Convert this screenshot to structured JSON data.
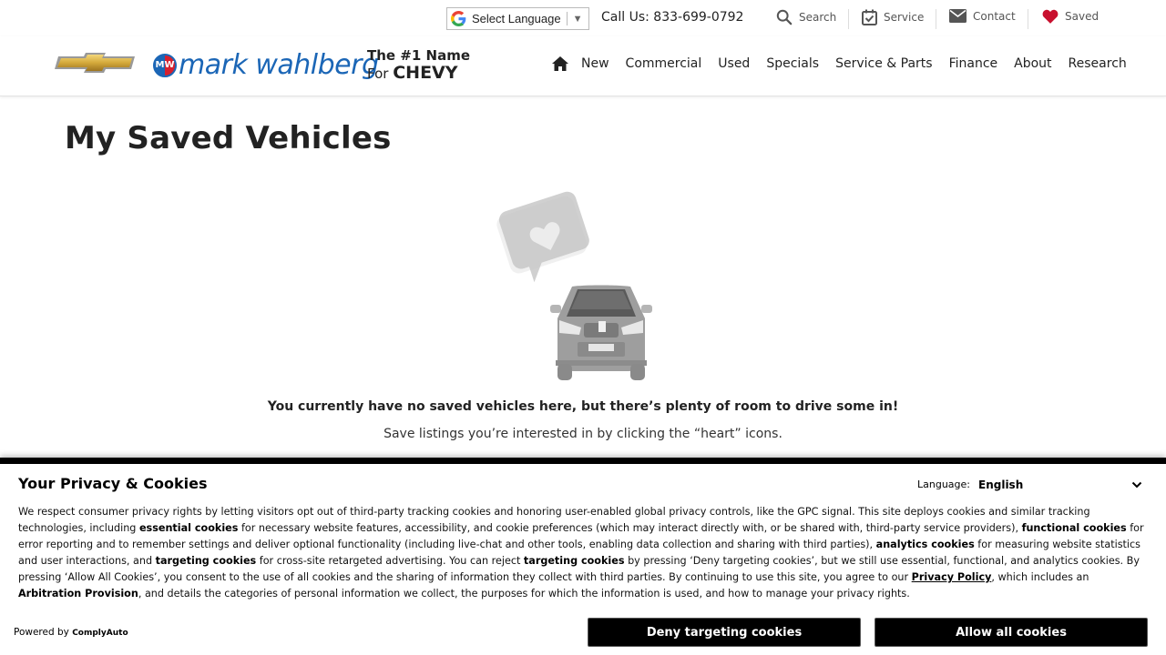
{
  "topbar": {
    "language_label": "Select Language",
    "call_label": "Call Us: 833-699-0792",
    "utility": [
      {
        "label": "Search",
        "icon": "search-icon"
      },
      {
        "label": "Service",
        "icon": "calendar-check-icon"
      },
      {
        "label": "Contact",
        "icon": "envelope-icon"
      },
      {
        "label": "Saved",
        "icon": "heart-icon"
      }
    ]
  },
  "header": {
    "brand_text": "mark wahlberg",
    "brand_badge": "MW",
    "tagline_line1": "The #1 Name",
    "tagline_for": "For",
    "tagline_chevy": "CHEVY",
    "nav": [
      "New",
      "Commercial",
      "Used",
      "Specials",
      "Service & Parts",
      "Finance",
      "About",
      "Research"
    ]
  },
  "main": {
    "title": "My Saved Vehicles",
    "empty_message": "You currently have no saved vehicles here, but there’s plenty of room to drive some in!",
    "empty_sub": "Save listings you’re interested in by clicking the “heart” icons."
  },
  "cookie": {
    "title": "Your Privacy & Cookies",
    "language_label": "Language:",
    "language_value": "English",
    "body": {
      "p1": "We respect consumer privacy rights by letting visitors opt out of third-party tracking cookies and honoring user-enabled global privacy controls, like the GPC signal. This site deploys cookies and similar tracking technologies, including ",
      "essential": "essential cookies",
      "p2": " for necessary website features, accessibility, and cookie preferences (which may interact directly with, or be shared with, third-party service providers), ",
      "functional": "functional cookies",
      "p3": " for error reporting and to remember settings and deliver optional functionality (including live-chat and other tools, enabling data collection and sharing with third parties), ",
      "analytics": "analytics cookies",
      "p4": " for measuring website statistics and user interactions, and ",
      "targeting": "targeting cookies",
      "p5": " for cross-site retargeted advertising. You can reject ",
      "targeting2": "targeting cookies",
      "p6": " by pressing ‘Deny targeting cookies’, but we still use essential, functional, and analytics cookies. By pressing ‘Allow All Cookies’, you consent to the use of all cookies and the sharing of information they collect with third parties. By continuing to use this site, you agree to our ",
      "privacy_link": "Privacy Policy",
      "p7": ", which includes an ",
      "arbitration": "Arbitration Provision",
      "p8": ", and details the categories of personal information we collect, the purposes for which the information is used, and how to manage your privacy rights."
    },
    "powered_by": "Powered by",
    "powered_brand": "ComplyAuto",
    "deny_button": "Deny targeting cookies",
    "allow_button": "Allow all cookies"
  },
  "colors": {
    "brand_blue": "#1b66b6",
    "brand_red": "#d6202e",
    "heart_red": "#c8102e",
    "chevy_gold": "#d4a93a"
  }
}
